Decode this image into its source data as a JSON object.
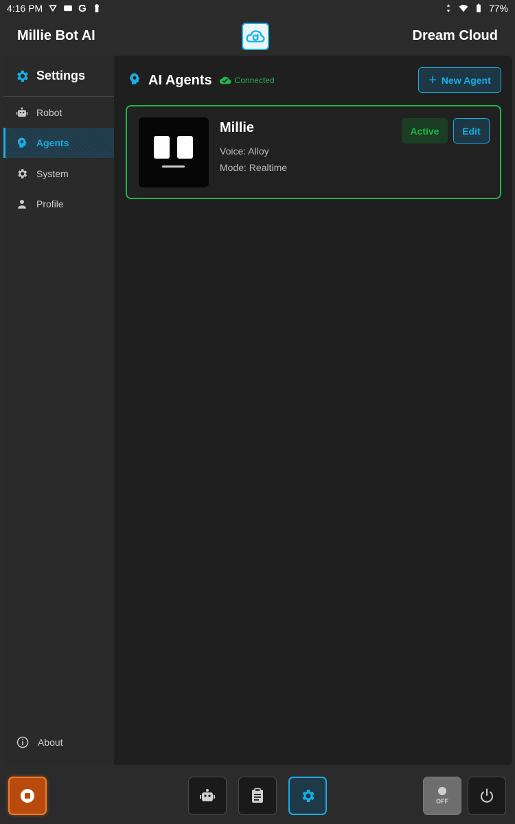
{
  "status_bar": {
    "time": "4:16 PM",
    "battery": "77%",
    "icons": [
      "vpn-icon",
      "message-icon",
      "google-icon",
      "keyhole-icon",
      "signal-icon",
      "wifi-icon",
      "battery-icon"
    ]
  },
  "header": {
    "app_title": "Millie Bot AI",
    "cloud_title": "Dream Cloud",
    "logo_icon": "dream-cloud-logo"
  },
  "sidebar": {
    "title": "Settings",
    "items": [
      {
        "label": "Robot",
        "icon": "robot-icon"
      },
      {
        "label": "Agents",
        "icon": "agent-head-icon",
        "active": true
      },
      {
        "label": "System",
        "icon": "gear-icon"
      },
      {
        "label": "Profile",
        "icon": "person-icon"
      }
    ],
    "about_label": "About"
  },
  "content": {
    "title": "AI Agents",
    "connection_status": "Connected",
    "new_agent_label": "New Agent",
    "agents": [
      {
        "name": "Millie",
        "voice": "Voice: Alloy",
        "mode": "Mode: Realtime",
        "status": "Active",
        "edit_label": "Edit"
      }
    ]
  },
  "bottom_bar": {
    "off_label": "OFF",
    "buttons": [
      "stop-icon",
      "robot-icon",
      "clipboard-icon",
      "gear-icon",
      "off-toggle",
      "power-icon"
    ]
  },
  "colors": {
    "accent": "#19aee6",
    "success": "#1fb54a",
    "stop": "#f07a2a",
    "background": "#1f1f1f"
  }
}
